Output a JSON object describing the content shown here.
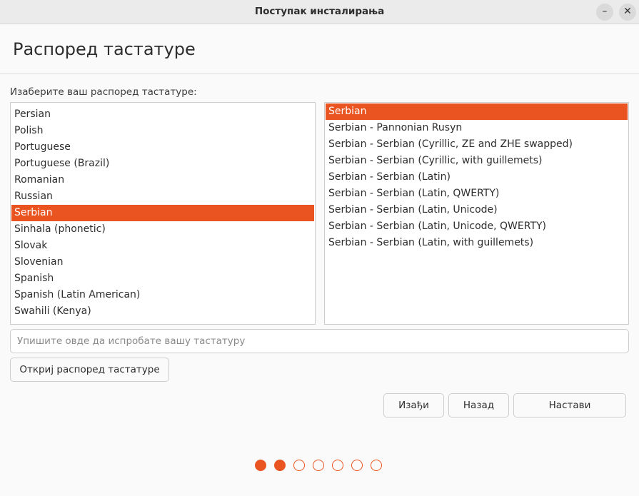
{
  "window": {
    "title": "Поступак инсталирања",
    "minimize_glyph": "–",
    "close_glyph": "✕"
  },
  "header": {
    "title": "Распоред тастатуре"
  },
  "prompt": "Изаберите ваш распоред тастатуре:",
  "layouts": {
    "selected": "Serbian",
    "items": [
      "Persian",
      "Polish",
      "Portuguese",
      "Portuguese (Brazil)",
      "Romanian",
      "Russian",
      "Serbian",
      "Sinhala (phonetic)",
      "Slovak",
      "Slovenian",
      "Spanish",
      "Spanish (Latin American)",
      "Swahili (Kenya)"
    ]
  },
  "variants": {
    "selected": "Serbian",
    "items": [
      "Serbian",
      "Serbian - Pannonian Rusyn",
      "Serbian - Serbian (Cyrillic, ZE and ZHE swapped)",
      "Serbian - Serbian (Cyrillic, with guillemets)",
      "Serbian - Serbian (Latin)",
      "Serbian - Serbian (Latin, QWERTY)",
      "Serbian - Serbian (Latin, Unicode)",
      "Serbian - Serbian (Latin, Unicode, QWERTY)",
      "Serbian - Serbian (Latin, with guillemets)"
    ]
  },
  "test_input": {
    "value": "",
    "placeholder": "Упишите овде да испробате вашу тастатуру"
  },
  "buttons": {
    "detect": "Откриј распоред тастатуре",
    "quit": "Изађи",
    "back": "Назад",
    "next": "Настави"
  },
  "progress": {
    "total_steps": 7,
    "completed_steps": 2
  },
  "colors": {
    "accent": "#e95420",
    "selection_text": "#ffffff"
  }
}
